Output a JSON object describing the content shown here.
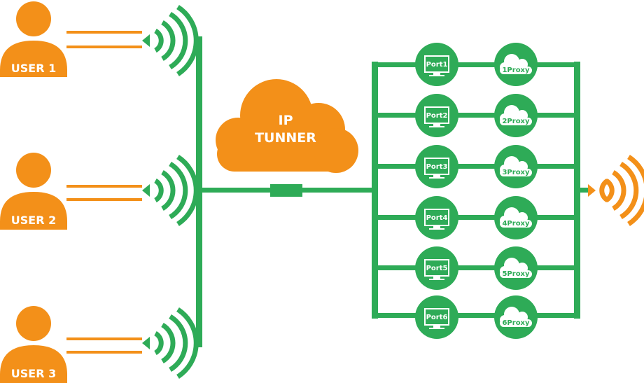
{
  "colors": {
    "orange": "#f39019",
    "green": "#2eab57",
    "white": "#ffffff"
  },
  "users": [
    {
      "label": "USER 1"
    },
    {
      "label": "USER 2"
    },
    {
      "label": "USER 3"
    }
  ],
  "tunnel": {
    "line1": "IP",
    "line2": "TUNNER"
  },
  "ports": [
    {
      "port": "Port1",
      "proxy": "1Proxy"
    },
    {
      "port": "Port2",
      "proxy": "2Proxy"
    },
    {
      "port": "Port3",
      "proxy": "3Proxy"
    },
    {
      "port": "Port4",
      "proxy": "4Proxy"
    },
    {
      "port": "Port5",
      "proxy": "5Proxy"
    },
    {
      "port": "Port6",
      "proxy": "6Proxy"
    }
  ],
  "icons": {
    "user": "person-icon",
    "wifi": "wifi-signal-icon",
    "cloud": "cloud-icon",
    "monitor": "monitor-icon",
    "proxy": "cloud-proxy-icon",
    "output": "wifi-signal-icon"
  }
}
